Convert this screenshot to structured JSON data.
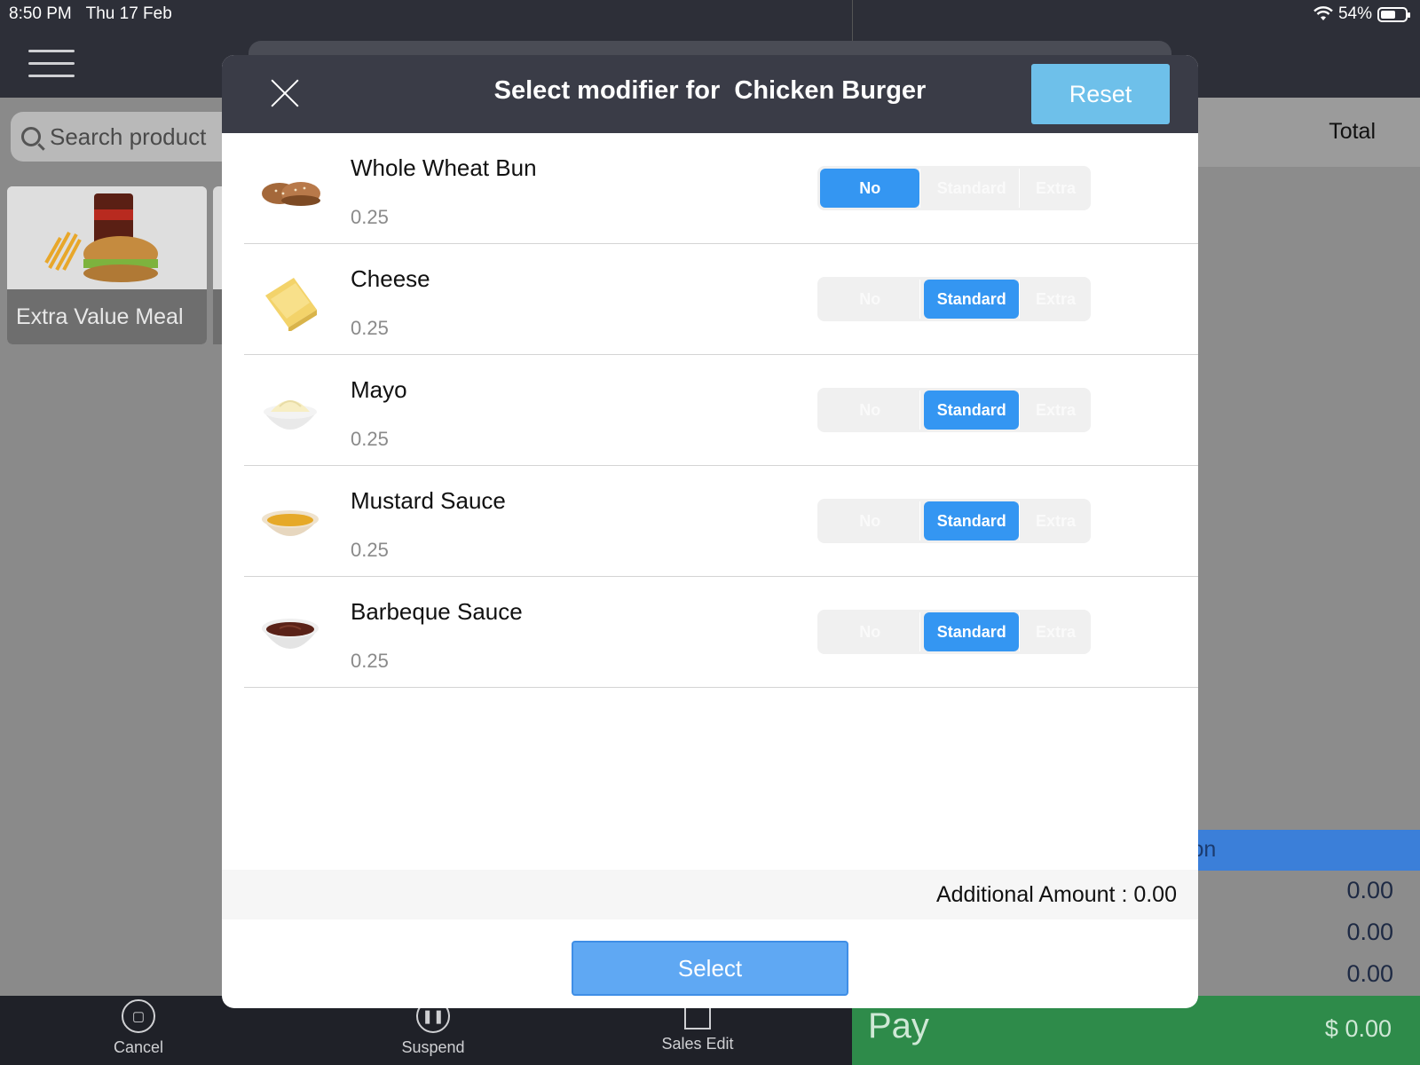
{
  "status_bar": {
    "time": "8:50 PM",
    "date": "Thu 17 Feb",
    "battery": "54%"
  },
  "search": {
    "placeholder": "Search product"
  },
  "product_tile": {
    "label": "Extra Value Meal"
  },
  "order_panel": {
    "total_header": "Total",
    "action_bar_text": "tion",
    "summary_values": [
      "0.00",
      "0.00",
      "0.00"
    ]
  },
  "bottom_bar": {
    "cancel": "Cancel",
    "suspend": "Suspend",
    "sales_edit": "Sales Edit"
  },
  "pay": {
    "label": "Pay",
    "amount": "$ 0.00"
  },
  "modal": {
    "title": "Select modifier for  Chicken Burger",
    "reset": "Reset",
    "option_labels": {
      "no": "No",
      "standard": "Standard",
      "extra": "Extra"
    },
    "modifiers": [
      {
        "name": "Whole Wheat Bun",
        "price": "0.25",
        "selected": "No",
        "image": "bun-image"
      },
      {
        "name": "Cheese",
        "price": "0.25",
        "selected": "Standard",
        "image": "cheese-image"
      },
      {
        "name": "Mayo",
        "price": "0.25",
        "selected": "Standard",
        "image": "mayo-image"
      },
      {
        "name": "Mustard Sauce",
        "price": "0.25",
        "selected": "Standard",
        "image": "mustard-image"
      },
      {
        "name": "Barbeque Sauce",
        "price": "0.25",
        "selected": "Standard",
        "image": "bbq-sauce-image"
      }
    ],
    "additional_amount": "Additional Amount : 0.00",
    "select": "Select"
  },
  "colors": {
    "header": "#3a3c47",
    "active_option": "#3496f2",
    "reset": "#6ec0ea",
    "pay": "#2e8b4a"
  }
}
